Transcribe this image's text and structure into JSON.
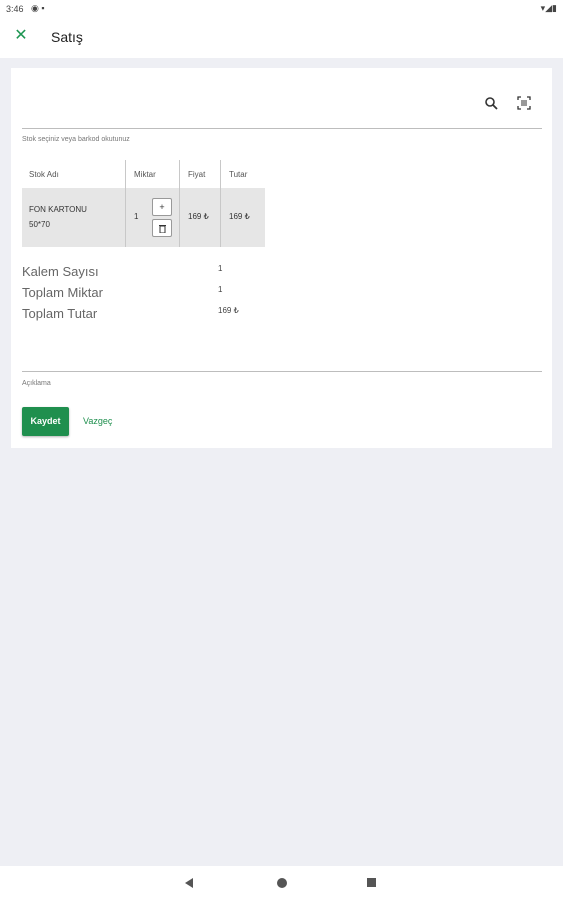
{
  "status_bar": {
    "time": "3:46"
  },
  "header": {
    "title": "Satış"
  },
  "stock_input": {
    "label": "Stok seçiniz veya barkod okutunuz"
  },
  "table": {
    "columns": [
      "Stok Adı",
      "Miktar",
      "Fiyat",
      "Tutar"
    ],
    "rows": [
      {
        "name_line1": "FON KARTONU",
        "name_line2": "50*70",
        "quantity": "1",
        "price": "169 ₺",
        "total": "169 ₺"
      }
    ]
  },
  "summary": {
    "item_count_label": "Kalem Sayısı",
    "item_count_value": "1",
    "total_qty_label": "Toplam Miktar",
    "total_qty_value": "1",
    "total_amount_label": "Toplam Tutar",
    "total_amount_value": "169 ₺"
  },
  "note": {
    "label": "Açıklama"
  },
  "actions": {
    "save_label": "Kaydet",
    "cancel_label": "Vazgeç"
  },
  "colors": {
    "accent": "#1f8f4e",
    "background": "#eeeff4"
  }
}
